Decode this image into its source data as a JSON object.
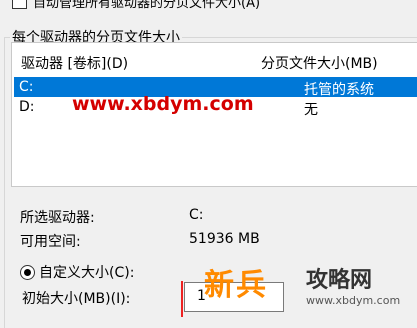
{
  "auto_manage": {
    "label": "自动管理所有驱动器的分页文件大小(A)"
  },
  "group": {
    "title": "每个驱动器的分页文件大小"
  },
  "list": {
    "headers": [
      "驱动器 [卷标](D)",
      "分页文件大小(MB)"
    ],
    "rows": [
      {
        "drive": "C:",
        "size": "托管的系统"
      },
      {
        "drive": "D:",
        "size": "无"
      }
    ]
  },
  "selected": {
    "drive_label": "所选驱动器:",
    "drive_value": "C:",
    "space_label": "可用空间:",
    "space_value": "51936 MB"
  },
  "custom": {
    "radio_label": "自定义大小(C):",
    "initial_label": "初始大小(MB)(I):",
    "initial_value": "1"
  },
  "watermarks": {
    "url": "www.xbdym.com",
    "big": "新兵",
    "cn": "攻略网",
    "small_url": "www.xbdym.com"
  },
  "colors": {
    "selection": "#0078d7",
    "background": "#f0f0f0",
    "watermark": "#d40000"
  }
}
